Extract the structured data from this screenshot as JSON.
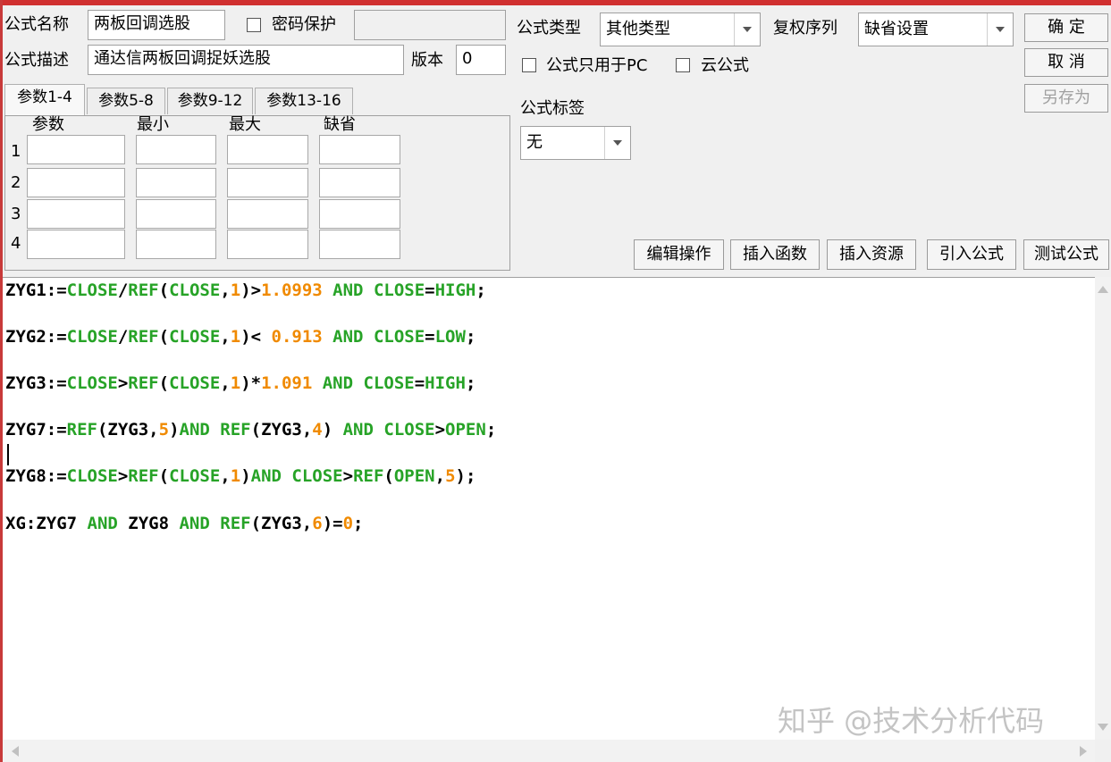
{
  "header": {
    "formula_name_label": "公式名称",
    "formula_name_value": "两板回调选股",
    "password_label": "密码保护",
    "formula_desc_label": "公式描述",
    "formula_desc_value": "通达信两板回调捉妖选股",
    "version_label": "版本",
    "version_value": "0",
    "formula_type_label": "公式类型",
    "formula_type_value": "其他类型",
    "rights_label": "复权序列",
    "rights_value": "缺省设置",
    "pc_only_label": "公式只用于PC",
    "cloud_label": "云公式",
    "tag_label": "公式标签",
    "tag_value": "无"
  },
  "actions": {
    "ok": "确 定",
    "cancel": "取 消",
    "save_as": "另存为"
  },
  "params": {
    "tabs": [
      "参数1-4",
      "参数5-8",
      "参数9-12",
      "参数13-16"
    ],
    "columns": [
      "参数",
      "最小",
      "最大",
      "缺省"
    ],
    "rows": [
      "1",
      "2",
      "3",
      "4"
    ]
  },
  "toolbar": [
    "编辑操作",
    "插入函数",
    "插入资源",
    "引入公式",
    "测试公式"
  ],
  "code": [
    [
      [
        "k",
        "ZYG1:="
      ],
      [
        "f",
        "CLOSE"
      ],
      [
        "k",
        "/"
      ],
      [
        "f",
        "REF"
      ],
      [
        "k",
        "("
      ],
      [
        "f",
        "CLOSE"
      ],
      [
        "k",
        ","
      ],
      [
        "n",
        "1"
      ],
      [
        "k",
        ")>"
      ],
      [
        "n",
        "1.0993"
      ],
      [
        "k",
        " "
      ],
      [
        "f",
        "AND"
      ],
      [
        "k",
        " "
      ],
      [
        "f",
        "CLOSE"
      ],
      [
        "k",
        "="
      ],
      [
        "f",
        "HIGH"
      ],
      [
        "k",
        ";"
      ]
    ],
    [
      [
        "k",
        "ZYG2:="
      ],
      [
        "f",
        "CLOSE"
      ],
      [
        "k",
        "/"
      ],
      [
        "f",
        "REF"
      ],
      [
        "k",
        "("
      ],
      [
        "f",
        "CLOSE"
      ],
      [
        "k",
        ","
      ],
      [
        "n",
        "1"
      ],
      [
        "k",
        ")< "
      ],
      [
        "n",
        "0.913"
      ],
      [
        "k",
        " "
      ],
      [
        "f",
        "AND"
      ],
      [
        "k",
        " "
      ],
      [
        "f",
        "CLOSE"
      ],
      [
        "k",
        "="
      ],
      [
        "f",
        "LOW"
      ],
      [
        "k",
        ";"
      ]
    ],
    [
      [
        "k",
        "ZYG3:="
      ],
      [
        "f",
        "CLOSE"
      ],
      [
        "k",
        ">"
      ],
      [
        "f",
        "REF"
      ],
      [
        "k",
        "("
      ],
      [
        "f",
        "CLOSE"
      ],
      [
        "k",
        ","
      ],
      [
        "n",
        "1"
      ],
      [
        "k",
        ")*"
      ],
      [
        "n",
        "1.091"
      ],
      [
        "k",
        " "
      ],
      [
        "f",
        "AND"
      ],
      [
        "k",
        " "
      ],
      [
        "f",
        "CLOSE"
      ],
      [
        "k",
        "="
      ],
      [
        "f",
        "HIGH"
      ],
      [
        "k",
        ";"
      ]
    ],
    [
      [
        "k",
        "ZYG7:="
      ],
      [
        "f",
        "REF"
      ],
      [
        "k",
        "(ZYG3,"
      ],
      [
        "n",
        "5"
      ],
      [
        "k",
        ")"
      ],
      [
        "f",
        "AND"
      ],
      [
        "k",
        " "
      ],
      [
        "f",
        "REF"
      ],
      [
        "k",
        "(ZYG3,"
      ],
      [
        "n",
        "4"
      ],
      [
        "k",
        ") "
      ],
      [
        "f",
        "AND"
      ],
      [
        "k",
        " "
      ],
      [
        "f",
        "CLOSE"
      ],
      [
        "k",
        ">"
      ],
      [
        "f",
        "OPEN"
      ],
      [
        "k",
        ";"
      ]
    ],
    [
      [
        "k",
        "ZYG8:="
      ],
      [
        "f",
        "CLOSE"
      ],
      [
        "k",
        ">"
      ],
      [
        "f",
        "REF"
      ],
      [
        "k",
        "("
      ],
      [
        "f",
        "CLOSE"
      ],
      [
        "k",
        ","
      ],
      [
        "n",
        "1"
      ],
      [
        "k",
        ")"
      ],
      [
        "f",
        "AND"
      ],
      [
        "k",
        " "
      ],
      [
        "f",
        "CLOSE"
      ],
      [
        "k",
        ">"
      ],
      [
        "f",
        "REF"
      ],
      [
        "k",
        "("
      ],
      [
        "f",
        "OPEN"
      ],
      [
        "k",
        ","
      ],
      [
        "n",
        "5"
      ],
      [
        "k",
        ");"
      ]
    ],
    [
      [
        "k",
        "XG:ZYG7 "
      ],
      [
        "f",
        "AND"
      ],
      [
        "k",
        " ZYG8 "
      ],
      [
        "f",
        "AND"
      ],
      [
        "k",
        " "
      ],
      [
        "f",
        "REF"
      ],
      [
        "k",
        "(ZYG3,"
      ],
      [
        "n",
        "6"
      ],
      [
        "k",
        ")="
      ],
      [
        "n",
        "0"
      ],
      [
        "k",
        ";"
      ]
    ]
  ],
  "watermark": "知乎 @技术分析代码",
  "colors": {
    "keyword": "#000000",
    "function": "#27a327",
    "number": "#f08a00",
    "accent_bar": "#d03030"
  }
}
